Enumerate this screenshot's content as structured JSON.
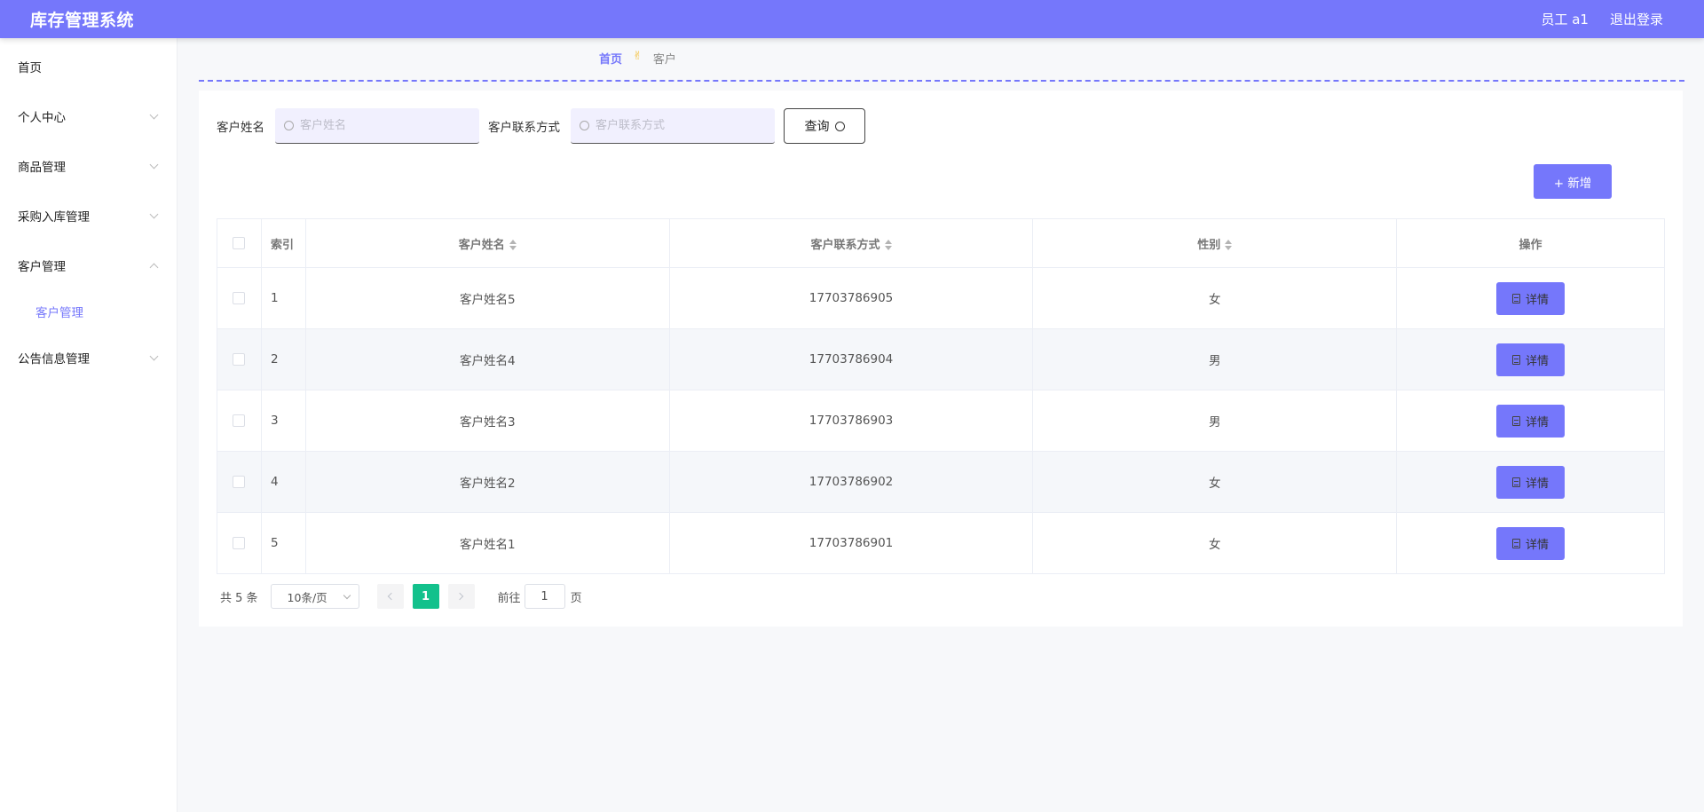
{
  "header": {
    "title": "库存管理系统",
    "user": "员工 a1",
    "logout": "退出登录"
  },
  "sidebar": {
    "items": [
      {
        "label": "首页"
      },
      {
        "label": "个人中心"
      },
      {
        "label": "商品管理"
      },
      {
        "label": "采购入库管理"
      },
      {
        "label": "客户管理"
      },
      {
        "label": "客户管理"
      },
      {
        "label": "公告信息管理"
      }
    ]
  },
  "breadcrumb": {
    "home": "首页",
    "separator": "✌",
    "current": "客户"
  },
  "search": {
    "name_label": "客户姓名",
    "name_placeholder": "客户姓名",
    "contact_label": "客户联系方式",
    "contact_placeholder": "客户联系方式",
    "query_label": "查询"
  },
  "add_button": "+ 新增",
  "table": {
    "headers": [
      "索引",
      "客户姓名",
      "客户联系方式",
      "性别",
      "操作"
    ],
    "detail_label": "详情",
    "rows": [
      {
        "index": "1",
        "name": "客户姓名5",
        "phone": "17703786905",
        "sex": "女"
      },
      {
        "index": "2",
        "name": "客户姓名4",
        "phone": "17703786904",
        "sex": "男"
      },
      {
        "index": "3",
        "name": "客户姓名3",
        "phone": "17703786903",
        "sex": "男"
      },
      {
        "index": "4",
        "name": "客户姓名2",
        "phone": "17703786902",
        "sex": "女"
      },
      {
        "index": "5",
        "name": "客户姓名1",
        "phone": "17703786901",
        "sex": "女"
      }
    ]
  },
  "pagination": {
    "total": "共 5 条",
    "page_size": "10条/页",
    "current_page": "1",
    "goto_label": "前往",
    "goto_value": "1",
    "page_suffix": "页"
  },
  "colors": {
    "accent": "#7577fb",
    "active_page": "#13c18c"
  }
}
